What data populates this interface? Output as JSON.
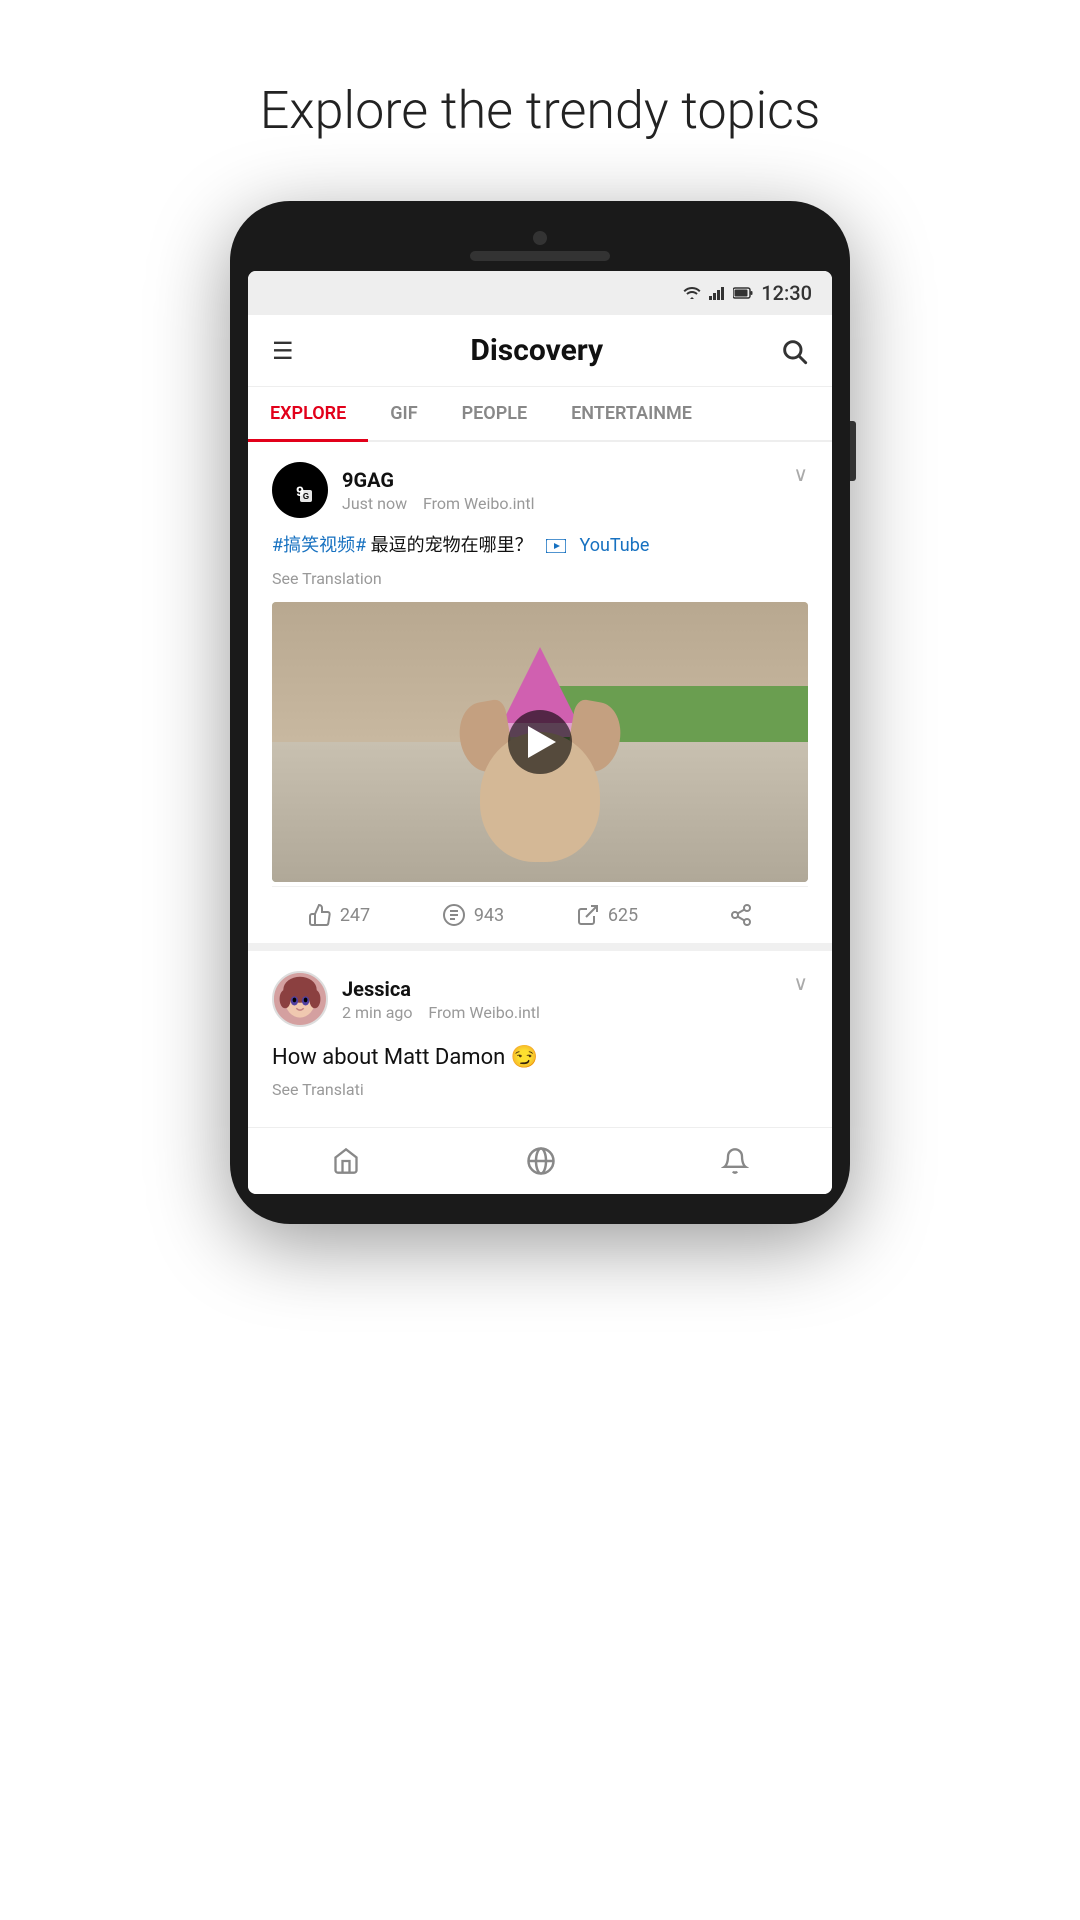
{
  "page": {
    "title": "Explore the trendy topics"
  },
  "status_bar": {
    "time": "12:30",
    "wifi": "▼",
    "signal": "▲",
    "battery": "🔋"
  },
  "header": {
    "title": "Discovery",
    "menu_icon": "☰",
    "search_icon": "🔍"
  },
  "tabs": [
    {
      "label": "EXPLORE",
      "active": true
    },
    {
      "label": "GIF",
      "active": false
    },
    {
      "label": "PEOPLE",
      "active": false
    },
    {
      "label": "ENTERTAINME",
      "active": false
    }
  ],
  "posts": [
    {
      "author": "9GAG",
      "time": "Just now",
      "source": "From Weibo.intl",
      "hashtag": "#搞笑视频#",
      "text_middle": " 最逗的宠物在哪里？",
      "youtube_label": "YouTube",
      "see_translation": "See Translation",
      "likes": "247",
      "comments": "943",
      "reposts": "625"
    },
    {
      "author": "Jessica",
      "time": "2 min ago",
      "source": "From Weibo.intl",
      "text": "How about Matt Damon 😏",
      "see_translation": "See Translati"
    }
  ],
  "bottom_nav": [
    {
      "icon": "home",
      "label": "home"
    },
    {
      "icon": "explore",
      "label": "explore"
    },
    {
      "icon": "bell",
      "label": "notifications"
    }
  ],
  "colors": {
    "accent_red": "#e2001a",
    "link_blue": "#1771c0",
    "text_dark": "#111111",
    "text_gray": "#999999"
  }
}
